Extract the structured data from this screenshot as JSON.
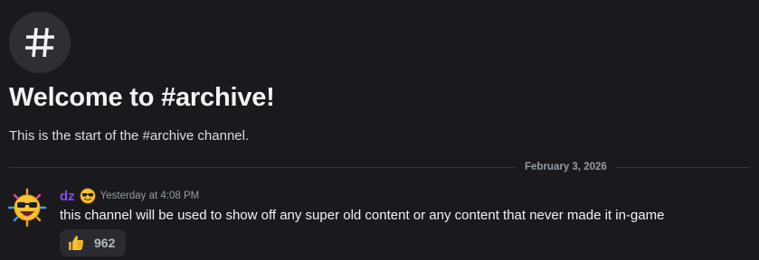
{
  "channel": {
    "icon": "hash-icon",
    "welcome_title": "Welcome to #archive!",
    "welcome_subtitle": "This is the start of the #archive channel."
  },
  "divider": {
    "date": "February 3, 2026"
  },
  "message": {
    "author": "dz",
    "author_color": "#8a4df0",
    "avatar_icon": "sunglasses-sun-avatar",
    "badge_icon": "sunglasses-emoji-icon",
    "timestamp": "Yesterday at 4:08 PM",
    "text": "this channel will be used to show off any super old content or any content that never made it in-game",
    "reactions": [
      {
        "emoji": "thumbs-up-icon",
        "count": "962"
      }
    ]
  },
  "colors": {
    "background": "#1a1a1e",
    "text": "#dbdee1",
    "muted": "#949ba4",
    "reaction_bg": "#2a2b31"
  }
}
